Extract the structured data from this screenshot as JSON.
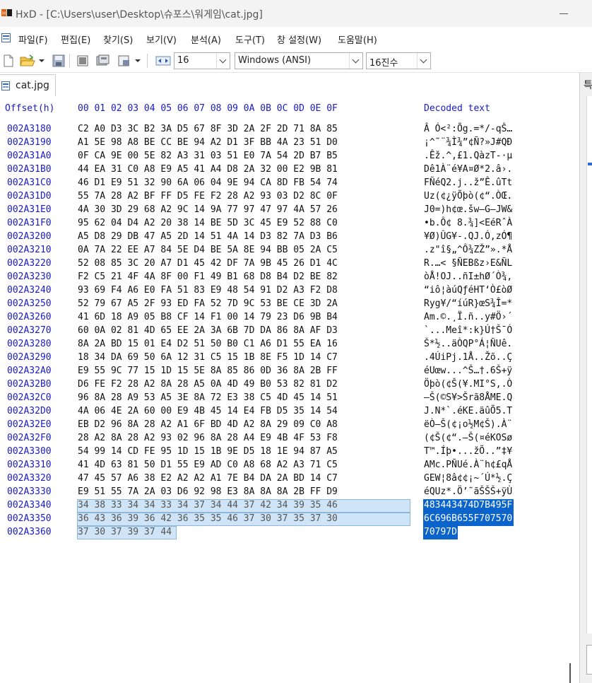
{
  "window": {
    "title": "HxD - [C:\\Users\\user\\Desktop\\슈포스\\워게임\\cat.jpg]"
  },
  "menu": [
    "파일(F)",
    "편집(E)",
    "찾기(S)",
    "보기(V)",
    "분석(A)",
    "도구(T)",
    "창 설정(W)",
    "도움말(H)"
  ],
  "toolbar": {
    "bytes_per_row": "16",
    "charset": "Windows (ANSI)",
    "offset_base": "16진수"
  },
  "tab": {
    "label": "cat.jpg"
  },
  "hex_view": {
    "offset_header": "Offset(h)",
    "columns_header": "00 01 02 03 04 05 06 07 08 09 0A 0B 0C 0D 0E 0F",
    "decoded_header": "Decoded text",
    "rows": [
      {
        "offset": "002A3180",
        "hex": "C2 A0 D3 3C B2 3A D5 67 8F 3D 2A 2F 2D 71 8A 85",
        "text": "Â Ó<²:Õg.=*/-qŠ…"
      },
      {
        "offset": "002A3190",
        "hex": "A1 5E 98 A8 BE CC BE 94 A2 D1 3F BB 4A 23 51 D0",
        "text": "¡^˜¨¾Ì¾”¢Ñ?»J#QÐ"
      },
      {
        "offset": "002A31A0",
        "hex": "0F CA 9E 00 5E 82 A3 31 03 51 E0 7A 54 2D B7 B5",
        "text": ".Êž.^‚£1.QàzT-·µ"
      },
      {
        "offset": "002A31B0",
        "hex": "44 EA 31 C0 A8 E9 A5 41 A4 D8 2A 32 00 E2 9B 81",
        "text": "Dê1À¨é¥A¤Ø*2.â›."
      },
      {
        "offset": "002A31C0",
        "hex": "46 D1 E9 51 32 90 6A 06 04 9E 94 CA 8D FB 54 74",
        "text": "FÑéQ2.j..ž”Ê.ûTt"
      },
      {
        "offset": "002A31D0",
        "hex": "55 7A 28 A2 BF FF D5 FE F2 28 A2 93 03 D2 8C 0F",
        "text": "Uz(¢¿ÿÕþò(¢“.ÒŒ."
      },
      {
        "offset": "002A31E0",
        "hex": "4A 30 3D 29 68 A2 9C 14 9A 77 97 47 97 4A 57 26",
        "text": "J0=)h¢œ.šw—G—JW&"
      },
      {
        "offset": "002A31F0",
        "hex": "95 62 04 D4 A2 20 38 14 BE 5D 3C 45 E9 52 88 C0",
        "text": "•b.Ô¢ 8.¾]<EéRˆÀ"
      },
      {
        "offset": "002A3200",
        "hex": "A5 D8 29 DB 47 A5 2D 14 51 4A 14 D3 82 7A D3 B6",
        "text": "¥Ø)ÛG¥-.QJ.Ó‚zÓ¶"
      },
      {
        "offset": "002A3210",
        "hex": "0A 7A 22 EE A7 84 5E D4 BE 5A 8E 94 BB 05 2A C5",
        "text": ".z\"î§„^Ô¾ZŽ”».*Å"
      },
      {
        "offset": "002A3220",
        "hex": "52 08 85 3C 20 A7 D1 45 42 DF 7A 9B 45 26 D1 4C",
        "text": "R.…< §ÑEBßz›E&ÑL"
      },
      {
        "offset": "002A3230",
        "hex": "F2 C5 21 4F 4A 8F 00 F1 49 B1 68 D8 B4 D2 BE 82",
        "text": "òÅ!OJ..ñI±hØ´Ò¾‚"
      },
      {
        "offset": "002A3240",
        "hex": "93 69 F4 A6 E0 FA 51 83 E9 48 54 91 D2 A3 F2 D8",
        "text": "“iô¦àúQƒéHT‘Ò£òØ"
      },
      {
        "offset": "002A3250",
        "hex": "52 79 67 A5 2F 93 ED FA 52 7D 9C 53 BE CE 3D 2A",
        "text": "Ryg¥/“íúR}œS¾Î=*"
      },
      {
        "offset": "002A3260",
        "hex": "41 6D 18 A9 05 B8 CF 14 F1 00 14 79 23 D6 9B B4",
        "text": "Am.©.¸Ï.ñ..y#Ö›´"
      },
      {
        "offset": "002A3270",
        "hex": "60 0A 02 81 4D 65 EE 2A 3A 6B 7D DA 86 8A AF D3",
        "text": "`...Meî*:k}Ú†Š¯Ó"
      },
      {
        "offset": "002A3280",
        "hex": "8A 2A BD 15 01 E4 D2 51 50 B0 C1 A6 D1 55 EA 16",
        "text": "Š*½..äÒQP°Á¦ÑUê."
      },
      {
        "offset": "002A3290",
        "hex": "18 34 DA 69 50 6A 12 31 C5 15 1B 8E F5 1D 14 C7",
        "text": ".4ÚiPj.1Å..Žõ..Ç"
      },
      {
        "offset": "002A32A0",
        "hex": "E9 55 9C 77 15 1D 15 5E 8A 85 86 0D 36 8A 2B FF",
        "text": "éUœw...^Š…†.6Š+ÿ"
      },
      {
        "offset": "002A32B0",
        "hex": "D6 FE F2 28 A2 8A 28 A5 0A 4D 49 B0 53 82 81 D2",
        "text": "Öþò(¢Š(¥.MI°S‚.Ò"
      },
      {
        "offset": "002A32C0",
        "hex": "96 8A 28 A9 53 A5 3E 8A 72 E3 38 C5 4D 45 14 51",
        "text": "–Š(©S¥>Šrã8ÅME.Q"
      },
      {
        "offset": "002A32D0",
        "hex": "4A 06 4E 2A 60 00 E9 4B 45 14 E4 FB D5 35 14 54",
        "text": "J.N*`.éKE.äûÕ5.T"
      },
      {
        "offset": "002A32E0",
        "hex": "EB D2 96 8A 28 A2 A1 6F BD 4D A2 8A 29 09 C0 A8",
        "text": "ëÒ–Š(¢¡o½M¢Š).À¨"
      },
      {
        "offset": "002A32F0",
        "hex": "28 A2 8A 28 A2 93 02 96 8A 28 A4 E9 4B 4F 53 F8",
        "text": "(¢Š(¢“.–Š(¤éKOSø"
      },
      {
        "offset": "002A3300",
        "hex": "54 99 14 CD FE 95 1D 15 1B 9E D5 18 1E 94 87 A5",
        "text": "T™.Íþ•...žÕ..”‡¥"
      },
      {
        "offset": "002A3310",
        "hex": "41 4D 63 81 50 D1 55 E9 AD C0 A8 68 A2 A3 71 C5",
        "text": "AMc.PÑUé.À¨h¢£qÅ"
      },
      {
        "offset": "002A3320",
        "hex": "47 45 57 A6 38 E2 A2 A2 A1 7E B4 DA 2A BD 14 C7",
        "text": "GEW¦8â¢¢¡~´Ú*½.Ç"
      },
      {
        "offset": "002A3330",
        "hex": "E9 51 55 7A 2A 03 D6 92 98 E3 8A 8A 8A 2B FF D9",
        "text": "éQUz*.Ö’˜ãŠŠŠ+ÿÙ"
      },
      {
        "offset": "002A3340",
        "hex": "34 38 33 34 34 33 34 37 34 44 37 42 34 39 35 46",
        "text": "483443474D7B495F"
      },
      {
        "offset": "002A3350",
        "hex": "36 43 36 39 36 42 36 35 35 46 37 30 37 35 37 30",
        "text": "6C696B655F707570"
      },
      {
        "offset": "002A3360",
        "hex": "37 30 37 39 37 44",
        "text": "70797D"
      }
    ],
    "selected_rows_start": 28
  },
  "right_panel": {
    "tab_initial": "특"
  }
}
